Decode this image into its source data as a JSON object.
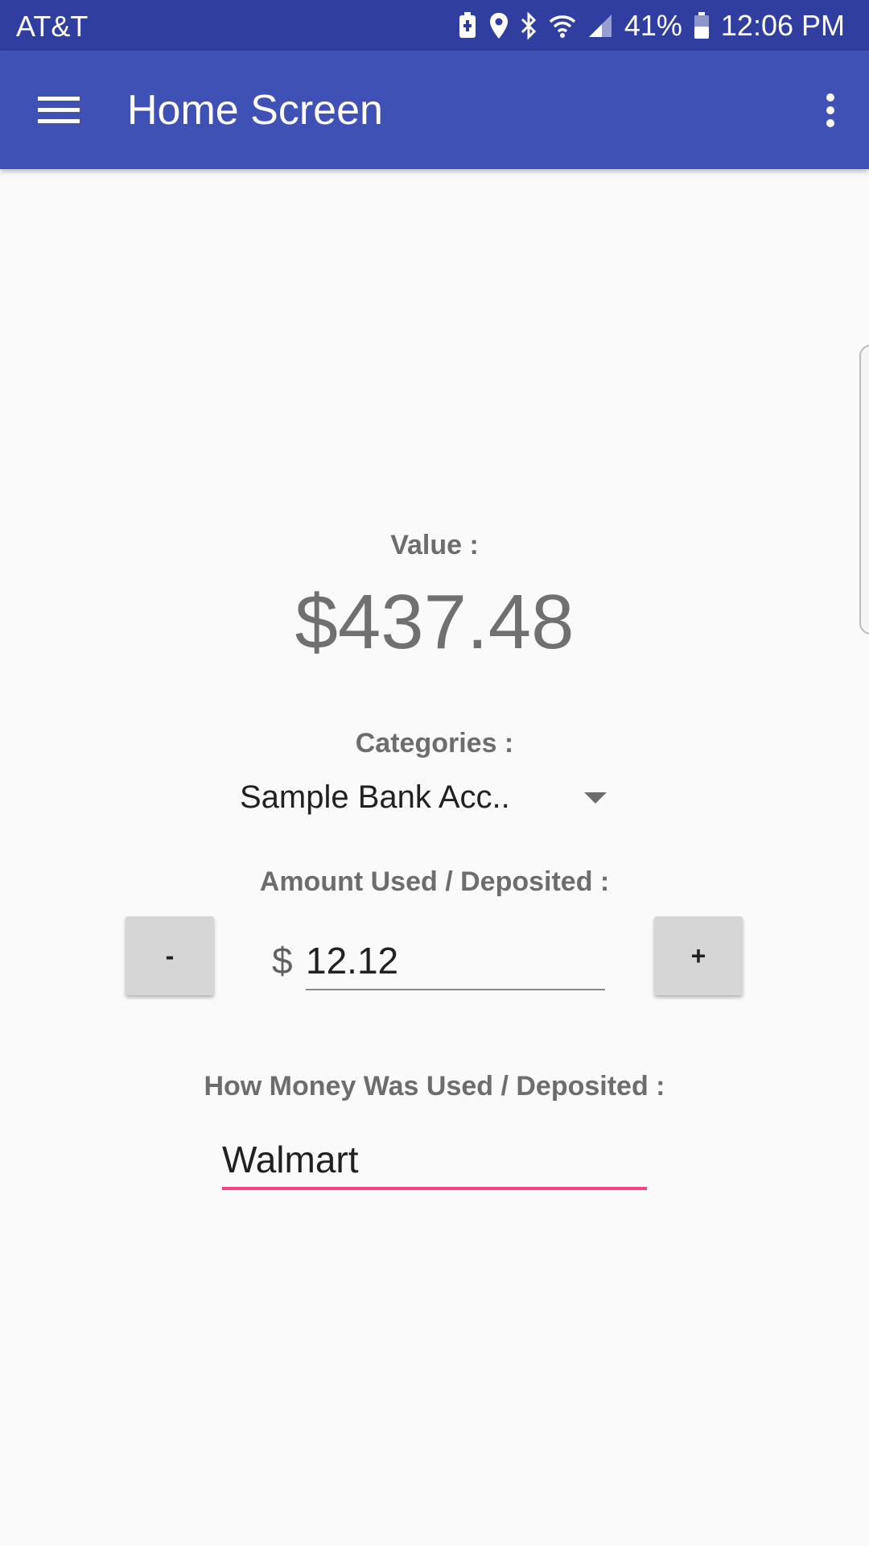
{
  "status_bar": {
    "carrier": "AT&T",
    "battery_percent": "41%",
    "time": "12:06 PM",
    "icons": [
      "battery-saver-icon",
      "location-icon",
      "bluetooth-icon",
      "wifi-icon",
      "signal-icon",
      "battery-icon"
    ]
  },
  "app_bar": {
    "title": "Home Screen",
    "menu_icon": "hamburger-menu-icon",
    "overflow_icon": "more-vert-icon"
  },
  "main": {
    "value_label": "Value :",
    "value_amount": "$437.48",
    "categories_label": "Categories :",
    "category_selected": "Sample Bank Acc..",
    "amount_label": "Amount Used / Deposited  :",
    "minus_label": "-",
    "plus_label": "+",
    "currency_symbol": "$",
    "amount_value": "12.12",
    "description_label": "How Money Was Used / Deposited :",
    "description_value": "Walmart"
  },
  "colors": {
    "status_bar": "#303f9f",
    "app_bar": "#3f51b5",
    "accent": "#ff4081",
    "background": "#fafafa"
  }
}
